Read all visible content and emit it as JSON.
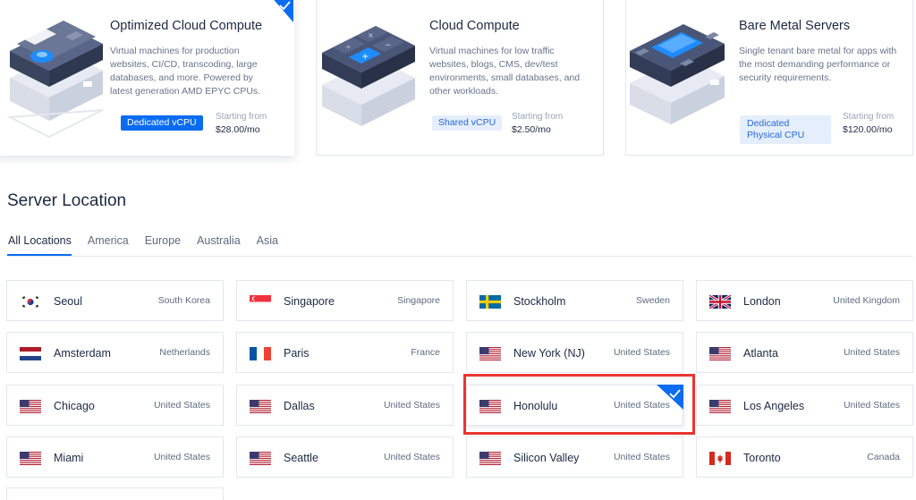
{
  "plans": [
    {
      "title": "Optimized Cloud Compute",
      "description": "Virtual machines for production websites, CI/CD, transcoding, large databases, and more. Powered by latest generation AMD EPYC CPUs.",
      "badge": "Dedicated vCPU",
      "price_label": "Starting from",
      "price": "$28.00/mo",
      "selected": true
    },
    {
      "title": "Cloud Compute",
      "description": "Virtual machines for low traffic websites, blogs, CMS, dev/test environments, small databases, and other workloads.",
      "badge": "Shared vCPU",
      "price_label": "Starting from",
      "price": "$2.50/mo",
      "selected": false
    },
    {
      "title": "Bare Metal Servers",
      "description": "Single tenant bare metal for apps with the most demanding performance or security requirements.",
      "badge_line1": "Dedicated",
      "badge_line2": "Physical CPU",
      "price_label": "Starting from",
      "price": "$120.00/mo",
      "selected": false
    }
  ],
  "section_title": "Server Location",
  "tabs": [
    {
      "label": "All Locations",
      "active": true
    },
    {
      "label": "America",
      "active": false
    },
    {
      "label": "Europe",
      "active": false
    },
    {
      "label": "Australia",
      "active": false
    },
    {
      "label": "Asia",
      "active": false
    }
  ],
  "locations": [
    {
      "city": "Seoul",
      "country": "South Korea",
      "flag": "korea-flag-icon"
    },
    {
      "city": "Singapore",
      "country": "Singapore",
      "flag": "singapore-flag-icon"
    },
    {
      "city": "Stockholm",
      "country": "Sweden",
      "flag": "sweden-flag-icon"
    },
    {
      "city": "London",
      "country": "United Kingdom",
      "flag": "uk-flag-icon"
    },
    {
      "city": "Amsterdam",
      "country": "Netherlands",
      "flag": "netherlands-flag-icon"
    },
    {
      "city": "Paris",
      "country": "France",
      "flag": "france-flag-icon"
    },
    {
      "city": "New York (NJ)",
      "country": "United States",
      "flag": "us-flag-icon"
    },
    {
      "city": "Atlanta",
      "country": "United States",
      "flag": "us-flag-icon"
    },
    {
      "city": "Chicago",
      "country": "United States",
      "flag": "us-flag-icon"
    },
    {
      "city": "Dallas",
      "country": "United States",
      "flag": "us-flag-icon"
    },
    {
      "city": "Honolulu",
      "country": "United States",
      "flag": "us-flag-icon",
      "selected": true
    },
    {
      "city": "Los Angeles",
      "country": "United States",
      "flag": "us-flag-icon"
    },
    {
      "city": "Miami",
      "country": "United States",
      "flag": "us-flag-icon"
    },
    {
      "city": "Seattle",
      "country": "United States",
      "flag": "us-flag-icon"
    },
    {
      "city": "Silicon Valley",
      "country": "United States",
      "flag": "us-flag-icon"
    },
    {
      "city": "Toronto",
      "country": "Canada",
      "flag": "canada-flag-icon"
    }
  ],
  "colors": {
    "accent": "#0a6cf0",
    "highlight": "#e9362f",
    "text": "#1c2a44"
  }
}
